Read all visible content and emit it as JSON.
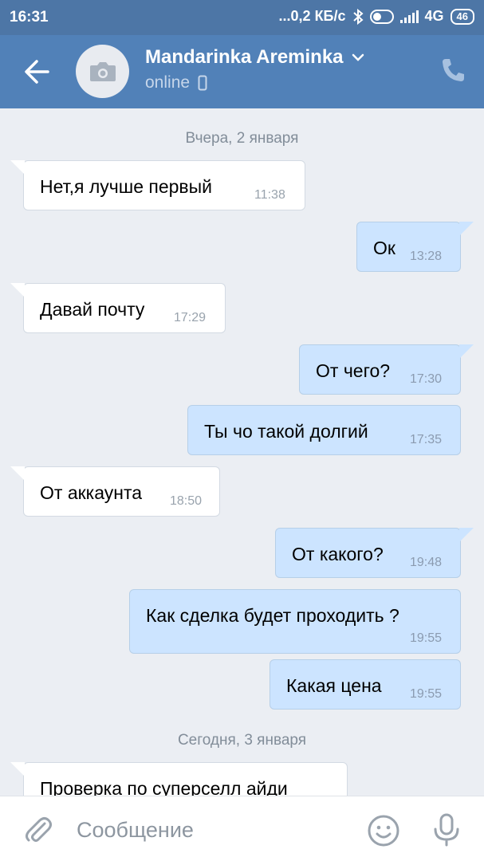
{
  "status": {
    "time": "16:31",
    "net": "...0,2 КБ/с",
    "network_type": "4G",
    "battery": "46"
  },
  "header": {
    "name": "Mandarinka Areminka",
    "status": "online"
  },
  "dates": [
    "Вчера, 2 января",
    "Сегодня, 3 января"
  ],
  "messages": [
    {
      "dir": "in",
      "text": "Нет,я лучше первый",
      "time": "11:38"
    },
    {
      "dir": "out",
      "text": "Ок",
      "time": "13:28"
    },
    {
      "dir": "in",
      "text": "Давай почту",
      "time": "17:29"
    },
    {
      "dir": "out",
      "text": "От чего?",
      "time": "17:30"
    },
    {
      "dir": "out",
      "text": "Ты чо такой долгий",
      "time": "17:35"
    },
    {
      "dir": "in",
      "text": "От аккаунта",
      "time": "18:50"
    },
    {
      "dir": "out",
      "text": "От какого?",
      "time": "19:48"
    },
    {
      "dir": "out",
      "text": "Как сделка будет проходить ?",
      "time": "19:55"
    },
    {
      "dir": "out",
      "text": "Какая цена",
      "time": "19:55"
    },
    {
      "dir": "in",
      "text": "Проверка по суперселл айди",
      "time": ""
    }
  ],
  "composer": {
    "placeholder": "Сообщение"
  }
}
